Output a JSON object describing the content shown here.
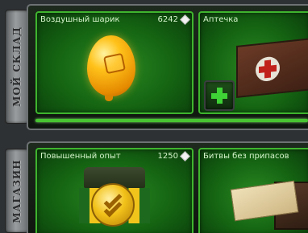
{
  "tabs": {
    "storage_label": "МОЙ СКЛАД",
    "shop_label": "МАГАЗИН"
  },
  "storage": {
    "items": [
      {
        "title": "Воздушный шарик",
        "price": "6242"
      },
      {
        "title": "Аптечка",
        "price": ""
      }
    ]
  },
  "shop": {
    "items": [
      {
        "title": "Повышенный опыт",
        "price": "1250"
      },
      {
        "title": "Битвы без припасов",
        "price": ""
      }
    ]
  },
  "icons": {
    "currency": "crystal-icon",
    "use_item": "plus-icon"
  },
  "colors": {
    "accent": "#3fb52e",
    "card_bg": "#146312",
    "text": "#d6f4cc"
  }
}
